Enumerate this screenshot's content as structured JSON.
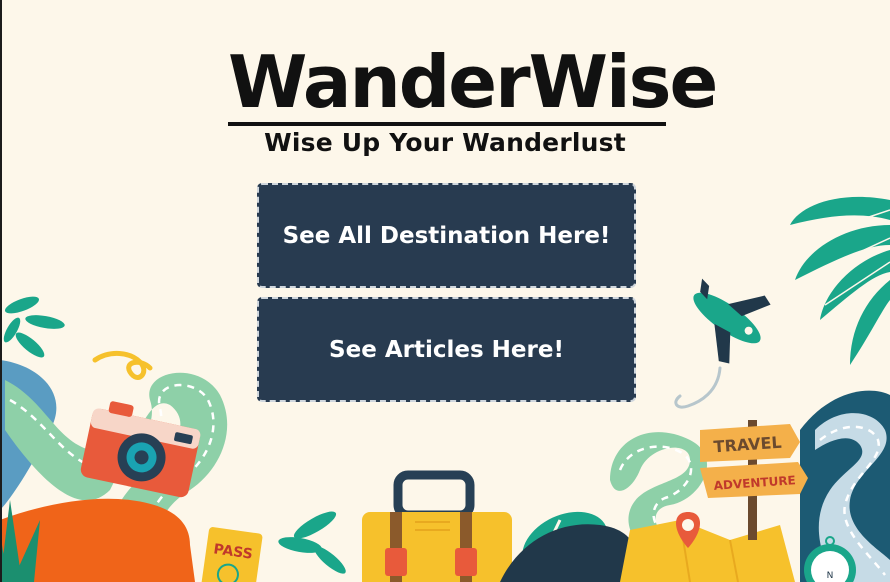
{
  "header": {
    "brand_title": "WanderWise",
    "tagline": "Wise Up Your Wanderlust"
  },
  "buttons": {
    "destinations_label": "See All Destination Here!",
    "articles_label": "See Articles Here!"
  },
  "illustration": {
    "sign_top": "TRAVEL",
    "sign_bottom": "ADVENTURE",
    "passport": "PASS",
    "colors": {
      "background": "#fdf7ea",
      "button": "#283b50",
      "teal": "#1aa68a",
      "orange": "#f06419",
      "yellow": "#f6c12c",
      "navy": "#21384a"
    }
  }
}
